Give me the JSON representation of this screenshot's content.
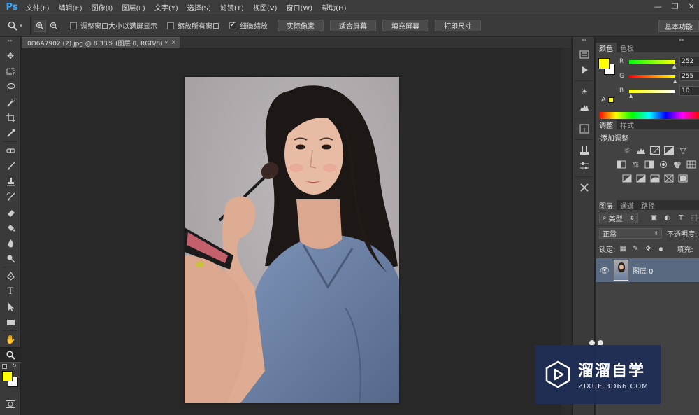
{
  "app": {
    "logo": "Ps"
  },
  "menu": [
    "文件(F)",
    "编辑(E)",
    "图像(I)",
    "图层(L)",
    "文字(Y)",
    "选择(S)",
    "滤镜(T)",
    "视图(V)",
    "窗口(W)",
    "帮助(H)"
  ],
  "window_controls": {
    "minimize": "—",
    "restore": "❐",
    "close": "✕"
  },
  "options": {
    "resize_windows": "调整窗口大小以满屏显示",
    "zoom_all_windows": "缩放所有窗口",
    "scrubby_zoom": "细微缩放",
    "scrubby_zoom_checked": true,
    "actual_pixels": "实际像素",
    "fit_screen": "适合屏幕",
    "fill_screen": "填充屏幕",
    "print_size": "打印尺寸",
    "workspace": "基本功能"
  },
  "document": {
    "tab_title": "0O6A7902 (2).jpg @ 8.33% (图层 0, RGB/8) *",
    "close": "×"
  },
  "panels": {
    "color_tab": "颜色",
    "swatches_tab": "色板",
    "rgb": {
      "r_label": "R",
      "r_value": "252",
      "g_label": "G",
      "g_value": "255",
      "b_label": "B",
      "b_value": "10"
    },
    "foreground_color": "#ffff00",
    "adjustments_tab": "调整",
    "styles_tab": "样式",
    "add_adjustment": "添加调整",
    "layers_tab": "图层",
    "channels_tab": "通道",
    "paths_tab": "路径",
    "filter_kind": "类型",
    "blend_mode": "正常",
    "opacity_label": "不透明度:",
    "lock_label": "锁定:",
    "fill_label": "填充:",
    "layer_name": "图层 0"
  },
  "watermark": {
    "name": "溜溜自学",
    "url": "ZIXUE.3D66.COM"
  }
}
